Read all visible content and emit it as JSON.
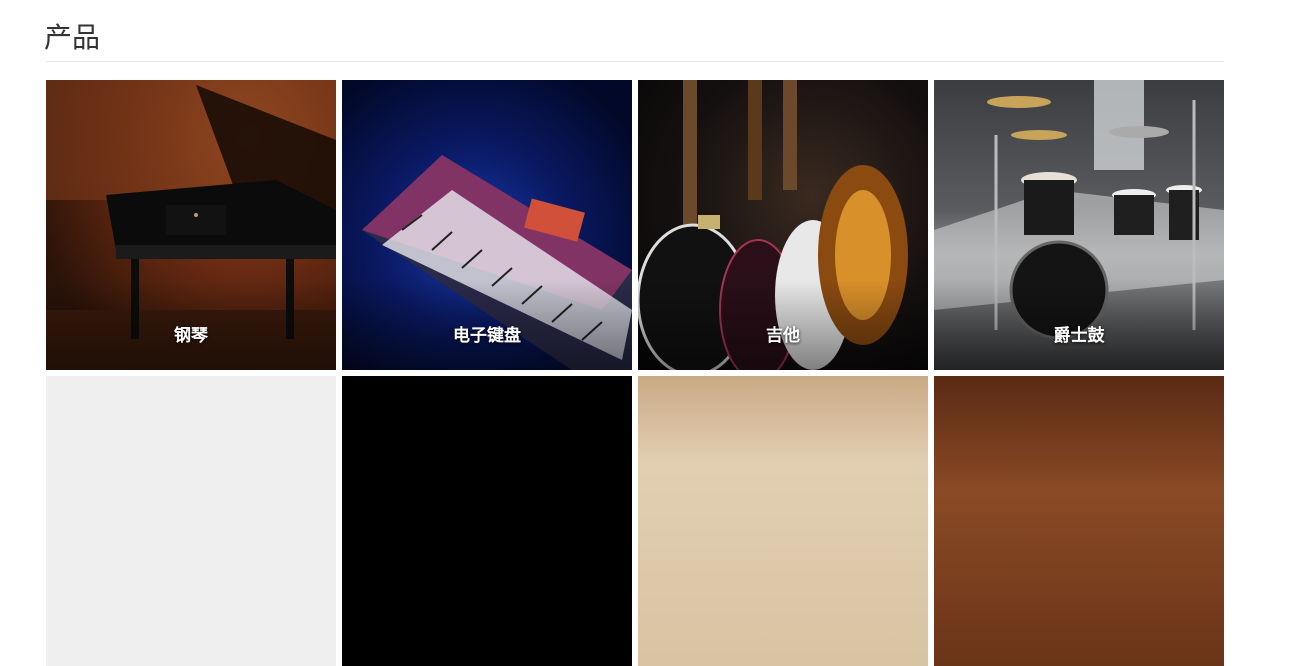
{
  "section": {
    "title": "产品"
  },
  "products": [
    {
      "label": "钢琴",
      "icon": "piano-image"
    },
    {
      "label": "电子键盘",
      "icon": "keyboard-image"
    },
    {
      "label": "吉他",
      "icon": "guitar-image"
    },
    {
      "label": "爵士鼓",
      "icon": "drum-kit-image"
    }
  ],
  "products_row2": [
    {
      "label": ""
    },
    {
      "label": ""
    },
    {
      "label": ""
    },
    {
      "label": ""
    }
  ],
  "colors": {
    "title_text": "#333333",
    "divider": "#e8e8e8",
    "label_text": "#ffffff"
  }
}
